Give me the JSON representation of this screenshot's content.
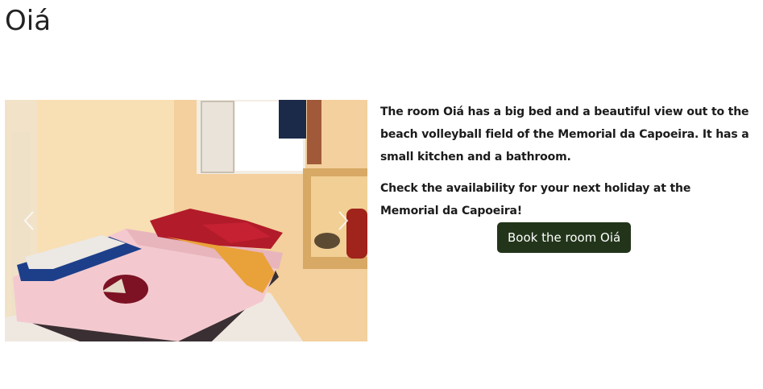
{
  "page": {
    "title": "Oiá"
  },
  "room": {
    "description": "The room Oiá has a big bed and a beautiful view out to the beach volleyball field of the Memorial da Capoeira. It has a small kitchen and a bathroom.",
    "availability": "Check the availability for your next holiday at the Memorial da Capoeira!",
    "book_label": "Book the room Oiá"
  },
  "carousel": {
    "prev_icon": "chevron-left-icon",
    "next_icon": "chevron-right-icon"
  },
  "colors": {
    "button_bg": "#22351a",
    "button_text": "#ffffff",
    "text": "#1b1b1b"
  }
}
